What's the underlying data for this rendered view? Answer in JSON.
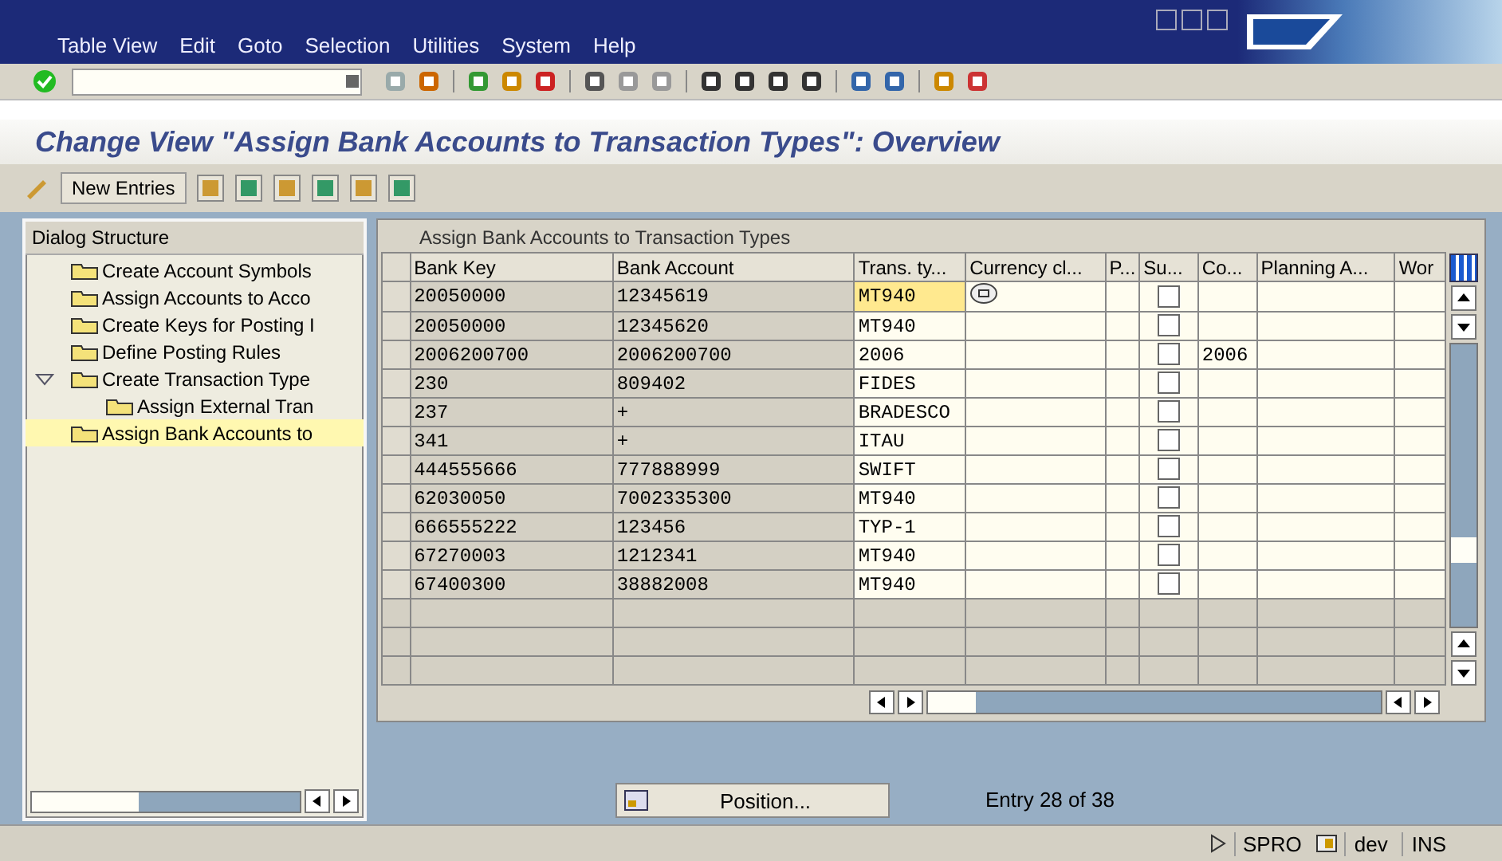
{
  "menu_bar": {
    "items": [
      "Table View",
      "Edit",
      "Goto",
      "Selection",
      "Utilities",
      "System",
      "Help"
    ]
  },
  "title": "Change View \"Assign Bank Accounts to Transaction Types\": Overview",
  "app_toolbar": {
    "button": "New Entries"
  },
  "dialog_structure": {
    "title": "Dialog Structure",
    "items": [
      {
        "label": "Create Account Symbols",
        "selected": false,
        "expanded": false
      },
      {
        "label": "Assign Accounts to Acco",
        "selected": false,
        "expanded": false
      },
      {
        "label": "Create Keys for Posting I",
        "selected": false,
        "expanded": false
      },
      {
        "label": "Define Posting Rules",
        "selected": false,
        "expanded": false
      },
      {
        "label": "Create Transaction Type",
        "selected": false,
        "expanded": true,
        "children": [
          {
            "label": "Assign External Tran",
            "selected": false
          }
        ]
      },
      {
        "label": "Assign Bank Accounts to",
        "selected": true,
        "expanded": false
      }
    ]
  },
  "table": {
    "title": "Assign Bank Accounts to Transaction Types",
    "columns": [
      "Bank Key",
      "Bank Account",
      "Trans. ty...",
      "Currency cl...",
      "P...",
      "Su...",
      "Co...",
      "Planning A...",
      "Wor"
    ],
    "rows": [
      {
        "bank_key": "20050000",
        "bank_account": "12345619",
        "trans_type": "MT940",
        "selected": true,
        "checked": false
      },
      {
        "bank_key": "20050000",
        "bank_account": "12345620",
        "trans_type": "MT940",
        "selected": false,
        "checked": false
      },
      {
        "bank_key": "2006200700",
        "bank_account": "2006200700",
        "trans_type": "2006",
        "co": "2006",
        "selected": false,
        "checked": false
      },
      {
        "bank_key": "230",
        "bank_account": "809402",
        "trans_type": "FIDES",
        "selected": false,
        "checked": false
      },
      {
        "bank_key": "237",
        "bank_account": "+",
        "trans_type": "BRADESCO",
        "selected": false,
        "checked": false
      },
      {
        "bank_key": "341",
        "bank_account": "+",
        "trans_type": "ITAU",
        "selected": false,
        "checked": false
      },
      {
        "bank_key": "444555666",
        "bank_account": "777888999",
        "trans_type": "SWIFT",
        "selected": false,
        "checked": false
      },
      {
        "bank_key": "62030050",
        "bank_account": "7002335300",
        "trans_type": "MT940",
        "selected": false,
        "checked": false
      },
      {
        "bank_key": "666555222",
        "bank_account": "123456",
        "trans_type": "TYP-1",
        "selected": false,
        "checked": false
      },
      {
        "bank_key": "67270003",
        "bank_account": "1212341",
        "trans_type": "MT940",
        "selected": false,
        "checked": false
      },
      {
        "bank_key": "67400300",
        "bank_account": "38882008",
        "trans_type": "MT940",
        "selected": false,
        "checked": false
      }
    ]
  },
  "position_button": "Position...",
  "entry_info": "Entry 28 of 38",
  "status_bar": {
    "transaction": "SPRO",
    "system": "dev",
    "mode": "INS"
  }
}
